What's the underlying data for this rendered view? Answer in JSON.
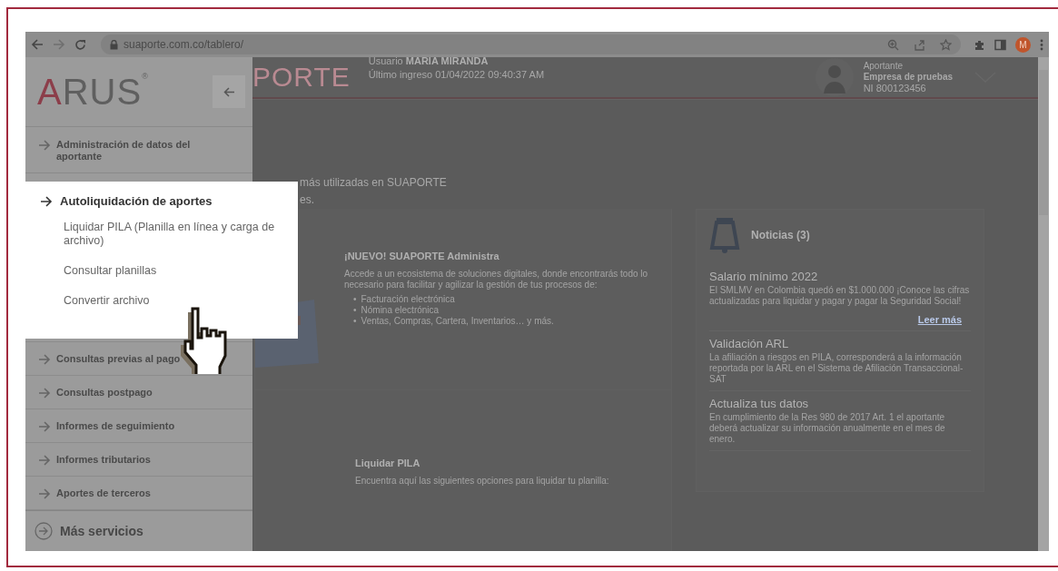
{
  "browser": {
    "url": "suaporte.com.co/tablero/",
    "profile_initial": "M"
  },
  "sidebar": {
    "logo": "ARUS$^{®}$",
    "items": [
      {
        "label": "Administración de datos del aportante"
      },
      {
        "label": "Consultas previas al pago"
      },
      {
        "label": "Consultas postpago"
      },
      {
        "label": "Informes de seguimiento"
      },
      {
        "label": "Informes tributarios"
      },
      {
        "label": "Aportes de terceros"
      }
    ],
    "more": "Más servicios"
  },
  "header": {
    "logo_text": "PORTE",
    "user_label": "Usuario",
    "user_name": "MARIA MIRANDA",
    "last_login": "Último ingreso 01/04/2022 09:40:37 AM",
    "account": {
      "role": "Aportante",
      "company": "Empresa de pruebas",
      "id": "NI 800123456"
    }
  },
  "intro": [
    "más utilizadas en SUAPORTE",
    "es."
  ],
  "cards": [
    {
      "title": "¡NUEVO! SUAPORTE Administra",
      "body": "Accede a un ecosistema de soluciones digitales, donde encontrarás todo lo necesario para facilitar y agilizar la gestión de tus procesos de:",
      "bullets": [
        {
          "marker": "•",
          "text": "Facturación electrónica"
        },
        {
          "marker": "•",
          "text": "Nómina electrónica"
        },
        {
          "marker": "•",
          "text": "Ventas, Compras, Cartera, Inventarios… y más."
        }
      ]
    },
    {
      "title": "Liquidar PILA",
      "body": "Encuentra aquí las siguientes opciones para liquidar tu planilla:"
    }
  ],
  "news": {
    "title": "Noticias (3)",
    "items": [
      {
        "title": "Salario mínimo 2022",
        "body": "El SMLMV en Colombia quedó en $1.000.000 ¡Conoce las cifras actualizadas para liquidar y pagar y pagar la Seguridad Social!",
        "link": "Leer más"
      },
      {
        "title": "Validación ARL",
        "body": "La afiliación a riesgos en PILA, corresponderá a la información reportada por la ARL en el Sistema de Afiliación Transaccional-SAT"
      },
      {
        "title": "Actualiza tus datos",
        "body": "En cumplimiento de la Res 980 de 2017 Art. 1 el aportante deberá actualizar su información anualmente en el mes de enero."
      }
    ]
  },
  "flyout": {
    "title": "Autoliquidación de aportes",
    "items": [
      "Liquidar PILA (Planilla en línea y carga de archivo)",
      "Consultar planillas",
      "Convertir archivo"
    ]
  }
}
